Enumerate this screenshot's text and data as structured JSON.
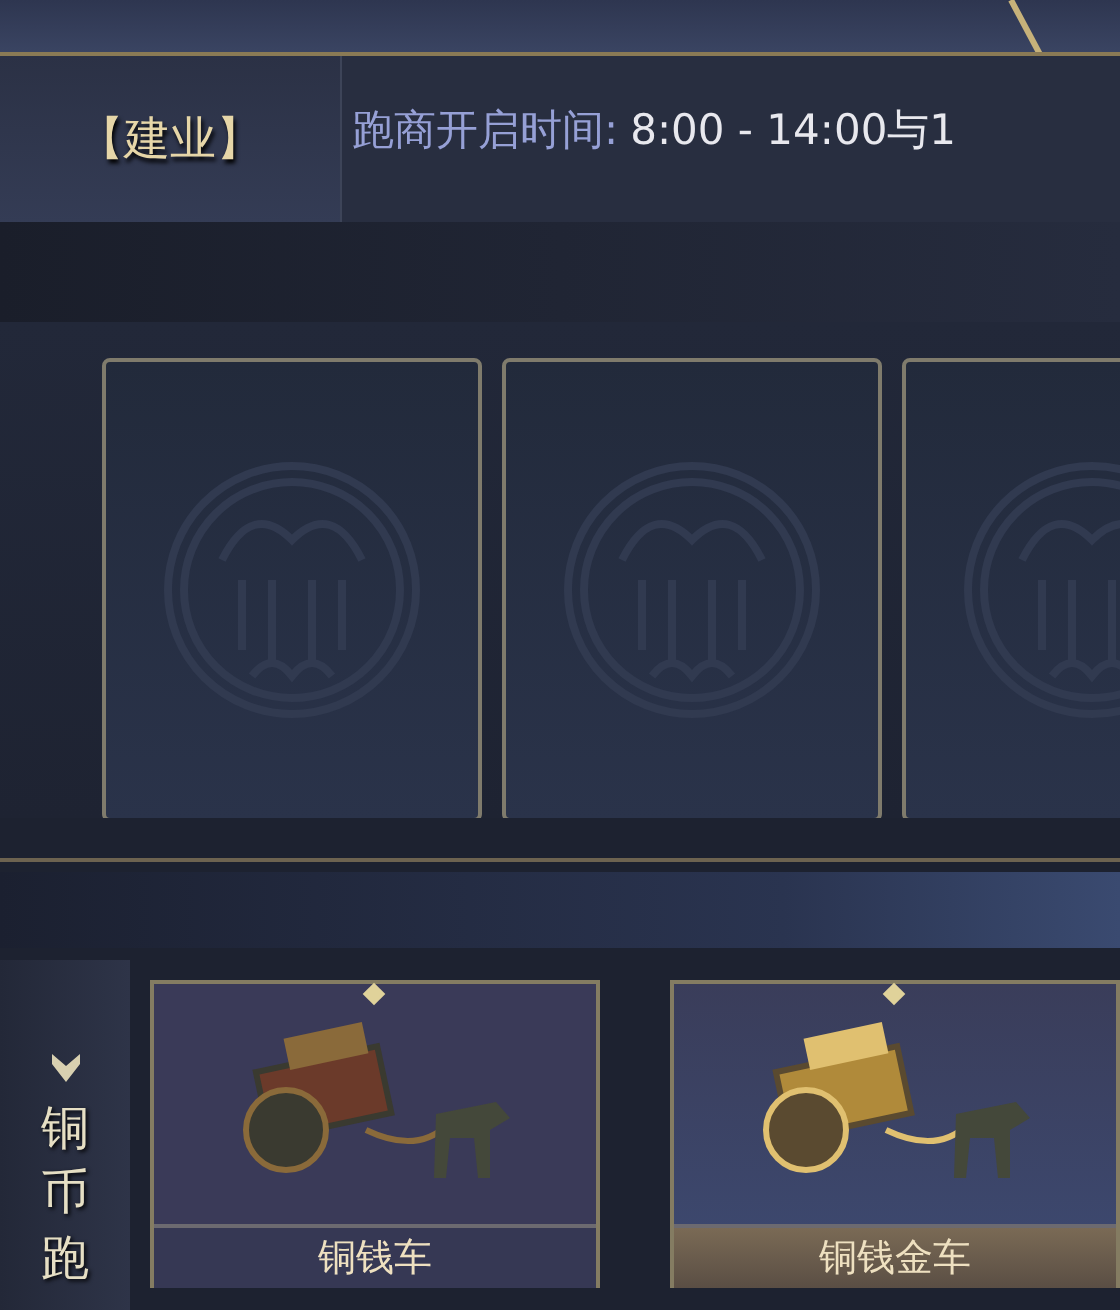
{
  "location": {
    "title": "【建业】"
  },
  "schedule": {
    "label": "跑商开启时间:",
    "value": "8:00 - 14:00与1"
  },
  "slots": [
    {
      "kind": "empty"
    },
    {
      "kind": "empty"
    },
    {
      "kind": "empty"
    }
  ],
  "category": {
    "label": "铜币跑"
  },
  "carts": [
    {
      "name": "铜钱车",
      "kind": "copper",
      "selected": false
    },
    {
      "name": "铜钱金车",
      "kind": "gold",
      "selected": true
    }
  ]
}
